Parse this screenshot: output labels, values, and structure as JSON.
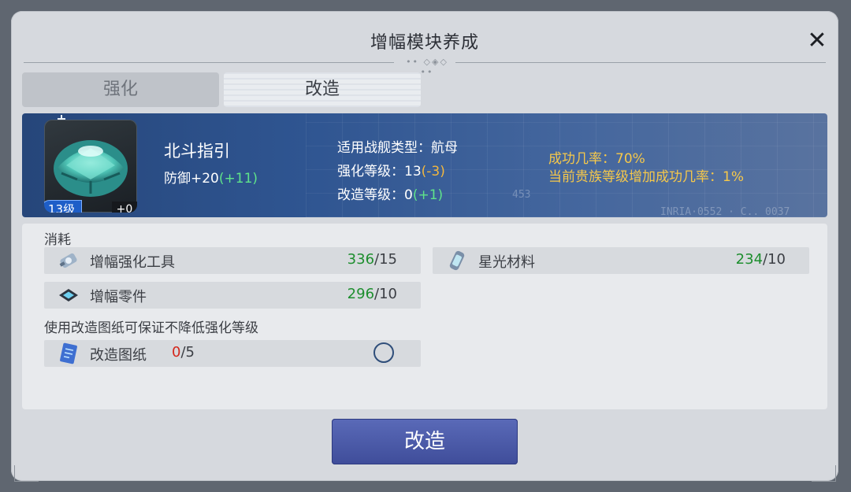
{
  "dialog": {
    "title": "增幅模块养成",
    "close_icon": "close-icon"
  },
  "tabs": [
    {
      "label": "强化",
      "active": false
    },
    {
      "label": "改造",
      "active": true
    }
  ],
  "item": {
    "name": "北斗指引",
    "level_badge": "13级",
    "enhance_badge": "+0",
    "stat_label": "防御",
    "stat_value": "+20",
    "stat_bonus": "(+11)"
  },
  "item_info": {
    "ship_type_label": "适用战舰类型：",
    "ship_type_value": "航母",
    "strengthen_label": "强化等级：",
    "strengthen_value": "13",
    "strengthen_change": "(-3)",
    "modify_label": "改造等级：",
    "modify_value": "0",
    "modify_change": "(+1)"
  },
  "success": {
    "rate_label": "成功几率：",
    "rate_value": "70%",
    "noble_label": "当前贵族等级增加成功几率：",
    "noble_value": "1%"
  },
  "consumption": {
    "label": "消耗",
    "materials": [
      {
        "name": "增幅强化工具",
        "have": "336",
        "need": "/15",
        "icon": "tool-icon"
      },
      {
        "name": "星光材料",
        "have": "234",
        "need": "/10",
        "icon": "starlight-material-icon"
      },
      {
        "name": "增幅零件",
        "have": "296",
        "need": "/10",
        "icon": "part-icon"
      }
    ]
  },
  "blueprint": {
    "hint": "使用改造图纸可保证不降低强化等级",
    "name": "改造图纸",
    "have": "0",
    "need": "/5",
    "icon": "blueprint-icon"
  },
  "action": {
    "label": "改造"
  },
  "colors": {
    "banner": "#2f5591",
    "gain_green": "#5fe38a",
    "loss_orange": "#f2b73f",
    "success_gold": "#f6c84a",
    "have_green": "#1d8e2e",
    "have_red": "#d4261b",
    "button": "#4a59a8"
  }
}
